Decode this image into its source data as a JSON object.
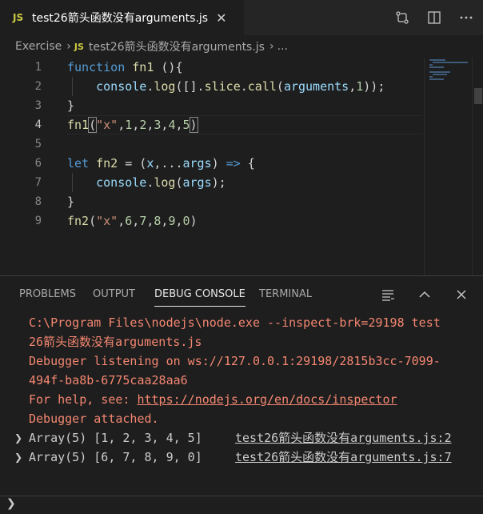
{
  "tab": {
    "badge": "JS",
    "title": "test26箭头函数没有arguments.js",
    "close": "✕"
  },
  "breadcrumb": {
    "folder": "Exercise",
    "badge": "JS",
    "file": "test26箭头函数没有arguments.js",
    "more": "..."
  },
  "editor": {
    "line_numbers": [
      "1",
      "2",
      "3",
      "4",
      "5",
      "6",
      "7",
      "8",
      "9"
    ],
    "active_line": "4"
  },
  "panel": {
    "tabs": [
      "PROBLEMS",
      "OUTPUT",
      "DEBUG CONSOLE",
      "TERMINAL"
    ],
    "active_tab": "DEBUG CONSOLE",
    "console": {
      "line1a": "C:\\Program Files\\nodejs\\node.exe --inspect-brk=29198 test",
      "line1b": "26箭头函数没有arguments.js",
      "line2a": "Debugger listening on ws://127.0.0.1:29198/2815b3cc-7099-",
      "line2b": "494f-ba8b-6775caa28aa6",
      "help_prefix": "For help, see: ",
      "help_link": "https://nodejs.org/en/docs/inspector",
      "attached": "Debugger attached.",
      "out1": "Array(5) [1, 2, 3, 4, 5]",
      "out1_src": "test26箭头函数没有arguments.js:2",
      "out2": "Array(5) [6, 7, 8, 9, 0]",
      "out2_src": "test26箭头函数没有arguments.js:7"
    },
    "prompt": "❯"
  },
  "colors": {
    "accent_js": "#cbcb41",
    "error_text": "#f48771",
    "editor_bg": "#1e1e1e"
  }
}
